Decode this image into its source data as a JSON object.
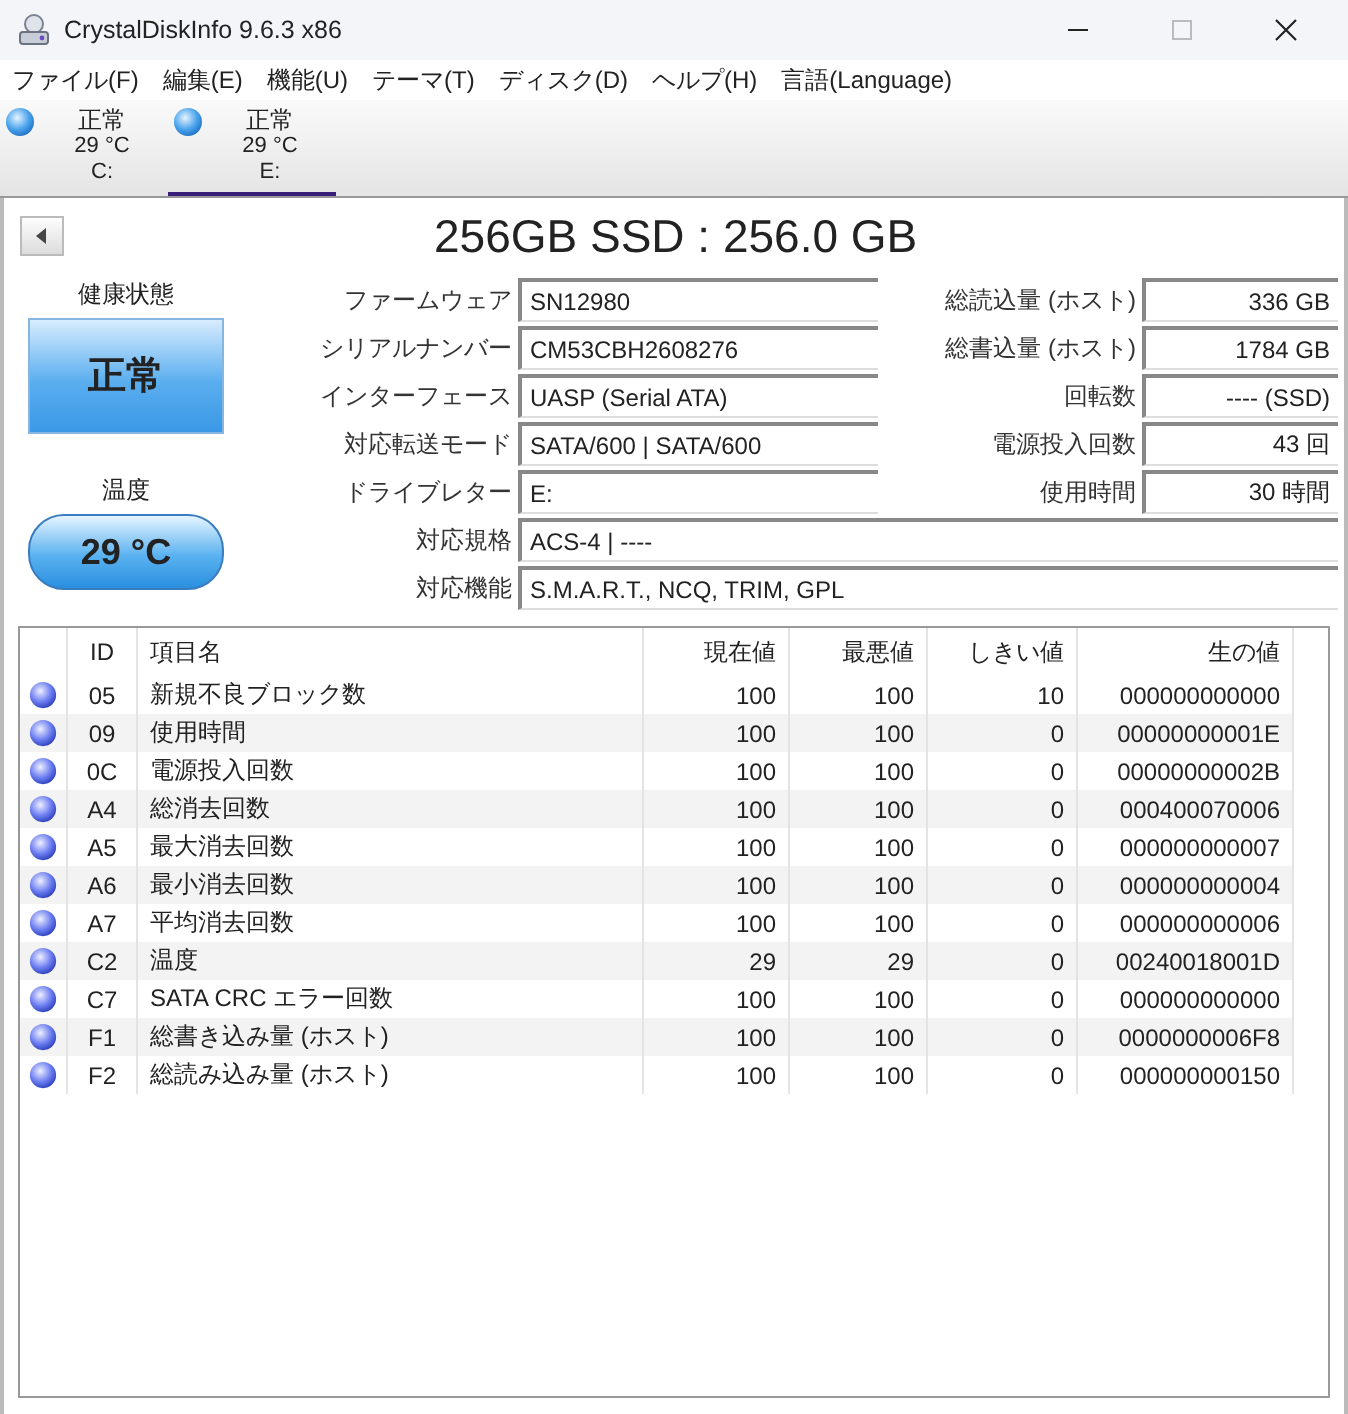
{
  "window": {
    "title": "CrystalDiskInfo 9.6.3 x86"
  },
  "menu": [
    "ファイル(F)",
    "編集(E)",
    "機能(U)",
    "テーマ(T)",
    "ディスク(D)",
    "ヘルプ(H)",
    "言語(Language)"
  ],
  "disks": [
    {
      "status": "正常",
      "temperature": "29 °C",
      "drive": "C:",
      "selected": false
    },
    {
      "status": "正常",
      "temperature": "29 °C",
      "drive": "E:",
      "selected": true
    }
  ],
  "title": "256GB SSD : 256.0 GB",
  "health": {
    "label": "健康状態",
    "status": "正常"
  },
  "temperature": {
    "label": "温度",
    "value": "29 °C"
  },
  "info_left": [
    {
      "label": "ファームウェア",
      "value": "SN12980"
    },
    {
      "label": "シリアルナンバー",
      "value": "CM53CBH2608276"
    },
    {
      "label": "インターフェース",
      "value": "UASP (Serial ATA)"
    },
    {
      "label": "対応転送モード",
      "value": "SATA/600 | SATA/600"
    },
    {
      "label": "ドライブレター",
      "value": "E:"
    }
  ],
  "info_right": [
    {
      "label": "総読込量 (ホスト)",
      "value": "336 GB"
    },
    {
      "label": "総書込量 (ホスト)",
      "value": "1784 GB"
    },
    {
      "label": "回転数",
      "value": "---- (SSD)"
    },
    {
      "label": "電源投入回数",
      "value": "43 回"
    },
    {
      "label": "使用時間",
      "value": "30 時間"
    }
  ],
  "info_wide": [
    {
      "label": "対応規格",
      "value": "ACS-4 | ----"
    },
    {
      "label": "対応機能",
      "value": "S.M.A.R.T., NCQ, TRIM, GPL"
    }
  ],
  "table": {
    "columns": [
      "ID",
      "項目名",
      "現在値",
      "最悪値",
      "しきい値",
      "生の値"
    ],
    "rows": [
      [
        "05",
        "新規不良ブロック数",
        "100",
        "100",
        "10",
        "000000000000"
      ],
      [
        "09",
        "使用時間",
        "100",
        "100",
        "0",
        "00000000001E"
      ],
      [
        "0C",
        "電源投入回数",
        "100",
        "100",
        "0",
        "00000000002B"
      ],
      [
        "A4",
        "総消去回数",
        "100",
        "100",
        "0",
        "000400070006"
      ],
      [
        "A5",
        "最大消去回数",
        "100",
        "100",
        "0",
        "000000000007"
      ],
      [
        "A6",
        "最小消去回数",
        "100",
        "100",
        "0",
        "000000000004"
      ],
      [
        "A7",
        "平均消去回数",
        "100",
        "100",
        "0",
        "000000000006"
      ],
      [
        "C2",
        "温度",
        "29",
        "29",
        "0",
        "00240018001D"
      ],
      [
        "C7",
        "SATA CRC エラー回数",
        "100",
        "100",
        "0",
        "000000000000"
      ],
      [
        "F1",
        "総書き込み量 (ホスト)",
        "100",
        "100",
        "0",
        "0000000006F8"
      ],
      [
        "F2",
        "総読み込み量 (ホスト)",
        "100",
        "100",
        "0",
        "000000000150"
      ]
    ]
  }
}
